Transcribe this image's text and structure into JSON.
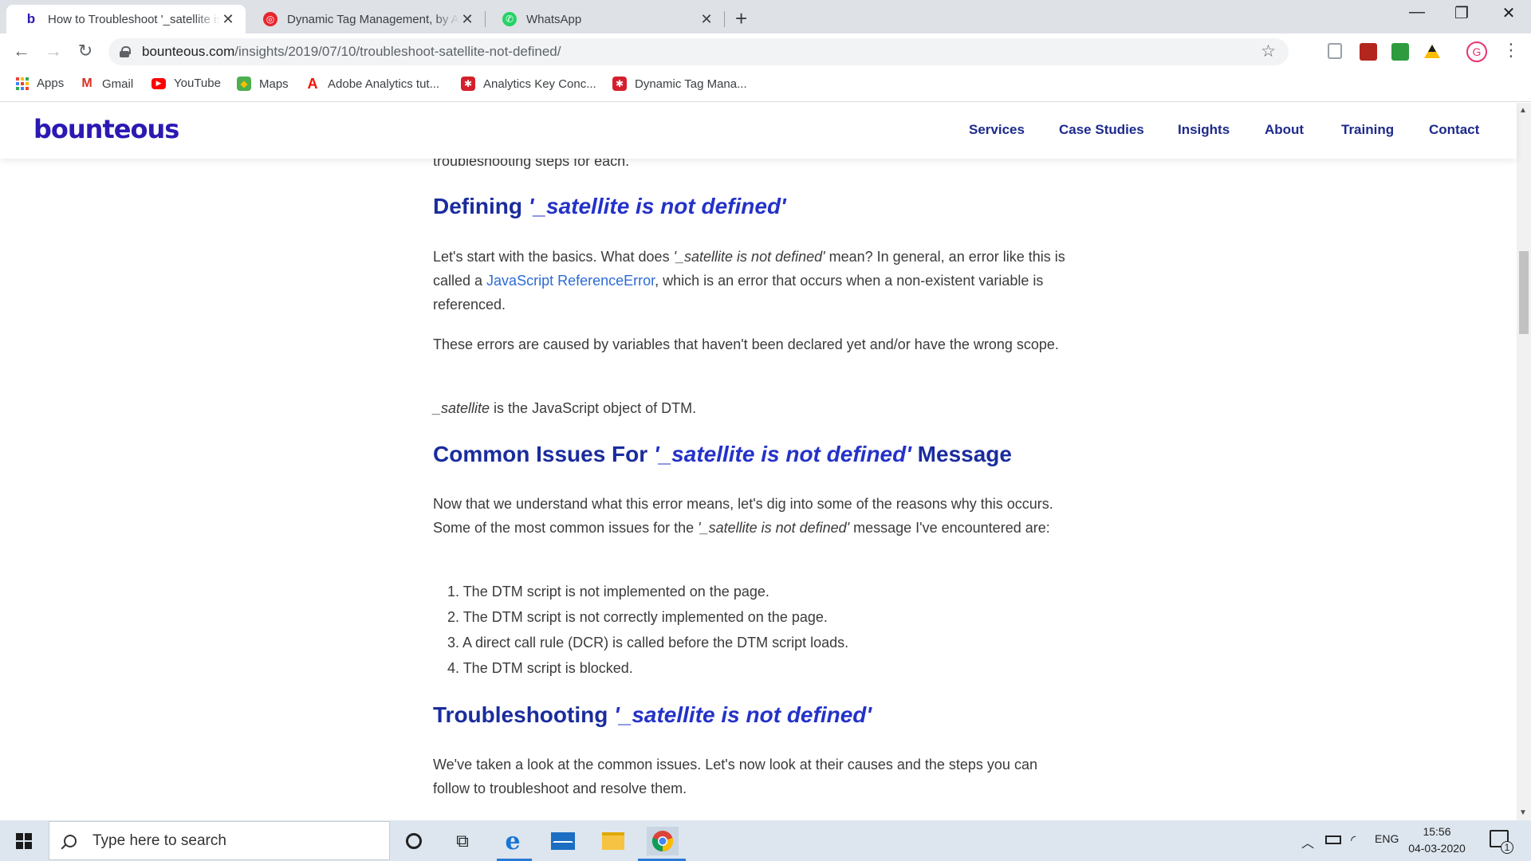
{
  "browser": {
    "tabs": [
      {
        "title": "How to Troubleshoot '_satellite is not defined'",
        "favicon_color": "#2b19b4",
        "favicon_glyph": "b",
        "active": true
      },
      {
        "title": "Dynamic Tag Management, by Adobe",
        "favicon_color": "#e8252f",
        "favicon_glyph": "◎",
        "active": false
      },
      {
        "title": "WhatsApp",
        "favicon_color": "#25d366",
        "favicon_glyph": "✆",
        "active": false
      }
    ],
    "new_tab_symbol": "+",
    "window_controls": {
      "minimize": "—",
      "restore": "❐",
      "close": "✕"
    },
    "toolbar": {
      "back": "←",
      "forward": "→",
      "reload": "↻",
      "url_host": "bounteous.com",
      "url_path": "/insights/2019/07/10/troubleshoot-satellite-not-defined/",
      "star": "☆",
      "avatar_letter": "G",
      "menu": "⋮"
    },
    "bookmarks": [
      {
        "label": "Apps",
        "icon": "apps-grid-icon"
      },
      {
        "label": "Gmail",
        "icon": "gmail-icon",
        "color": "#d93025",
        "glyph": "M"
      },
      {
        "label": "YouTube",
        "icon": "youtube-icon",
        "color": "#ff0000",
        "glyph": "▶"
      },
      {
        "label": "Maps",
        "icon": "maps-icon",
        "color": "#34a853",
        "glyph": "◆"
      },
      {
        "label": "Adobe Analytics tut...",
        "icon": "adobe-icon",
        "color": "#fa0f00",
        "glyph": "A"
      },
      {
        "label": "Analytics Key Conc...",
        "icon": "adobe-gear-icon",
        "color": "#d4202c",
        "glyph": "✱"
      },
      {
        "label": "Dynamic Tag Mana...",
        "icon": "adobe-gear-icon",
        "color": "#d4202c",
        "glyph": "✱"
      }
    ]
  },
  "site": {
    "logo": "bounteous",
    "nav": [
      "Services",
      "Case Studies",
      "Insights",
      "About",
      "Training",
      "Contact"
    ]
  },
  "article": {
    "cut_line": "troubleshooting steps for each.",
    "h_defining_pre": "Defining ",
    "h_defining_em": "'_satellite is not defined'",
    "p1_a": "Let's start with the basics. What does ",
    "p1_em": "'_satellite is not defined'",
    "p1_b": " mean? In general, an error like this is called a ",
    "p1_link": "JavaScript ReferenceError",
    "p1_c": ", which is an error that occurs when a non-existent variable is referenced.",
    "p2": "These errors are caused by variables that haven't been declared yet and/or have the wrong scope.",
    "p3_em": "_satellite",
    "p3_rest": " is the JavaScript object of DTM.",
    "h_common_pre": "Common Issues For ",
    "h_common_em": "'_satellite is not defined'",
    "h_common_post": " Message",
    "p4_a": "Now that we understand what this error means, let's dig into some of the reasons why this occurs. Some of the most common issues for the ",
    "p4_em": "'_satellite is not defined'",
    "p4_b": " message I've encountered are:",
    "list": [
      "1. The DTM script is not implemented on the page.",
      "2. The DTM script is not correctly implemented on the page.",
      "3. A direct call rule (DCR) is called before the DTM script loads.",
      "4. The DTM script is blocked."
    ],
    "h_trouble_pre": "Troubleshooting ",
    "h_trouble_em": "'_satellite is not defined'",
    "p5": "We've taken a look at the common issues. Let's now look at their causes and the steps you can follow to troubleshoot and resolve them."
  },
  "taskbar": {
    "search_placeholder": "Type here to search",
    "language": "ENG",
    "time": "15:56",
    "date": "04-03-2020",
    "notification_count": "1"
  }
}
